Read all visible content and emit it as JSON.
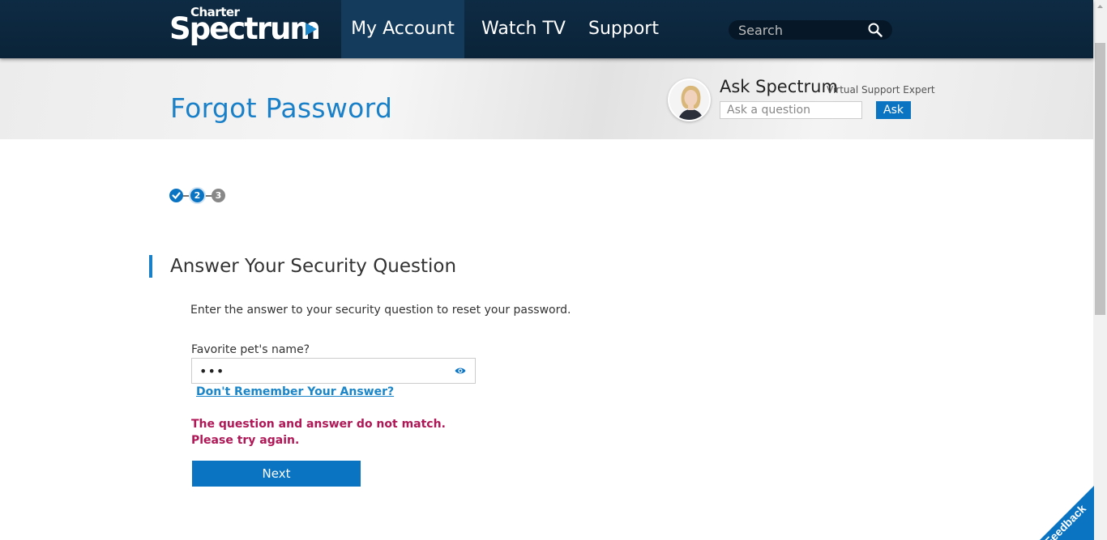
{
  "nav": {
    "logo_top": "Charter",
    "logo_main": "Spectrum",
    "items": [
      {
        "label": "My Account",
        "active": true
      },
      {
        "label": "Watch TV",
        "active": false
      },
      {
        "label": "Support",
        "active": false
      }
    ],
    "search_placeholder": "Search"
  },
  "header": {
    "title": "Forgot Password",
    "ask_title": "Ask Spectrum",
    "ask_subtitle": "Virtual Support Expert",
    "ask_placeholder": "Ask a question",
    "ask_button": "Ask"
  },
  "stepper": {
    "steps": [
      {
        "label": "✓",
        "state": "done"
      },
      {
        "label": "2",
        "state": "current"
      },
      {
        "label": "3",
        "state": "upcoming"
      }
    ]
  },
  "form": {
    "section_title": "Answer Your Security Question",
    "instructions": "Enter the answer to your security question to reset your password.",
    "question_label": "Favorite pet's name?",
    "answer_value": "•••",
    "forgot_link": "Don't Remember Your Answer?",
    "error_message": "The question and answer do not match. Please try again.",
    "next_button": "Next"
  },
  "feedback": {
    "label": "Feedback"
  },
  "colors": {
    "nav_bg": "#0e2b44",
    "accent_blue": "#0a74c3",
    "title_blue": "#1a80c8",
    "error": "#b01756"
  }
}
